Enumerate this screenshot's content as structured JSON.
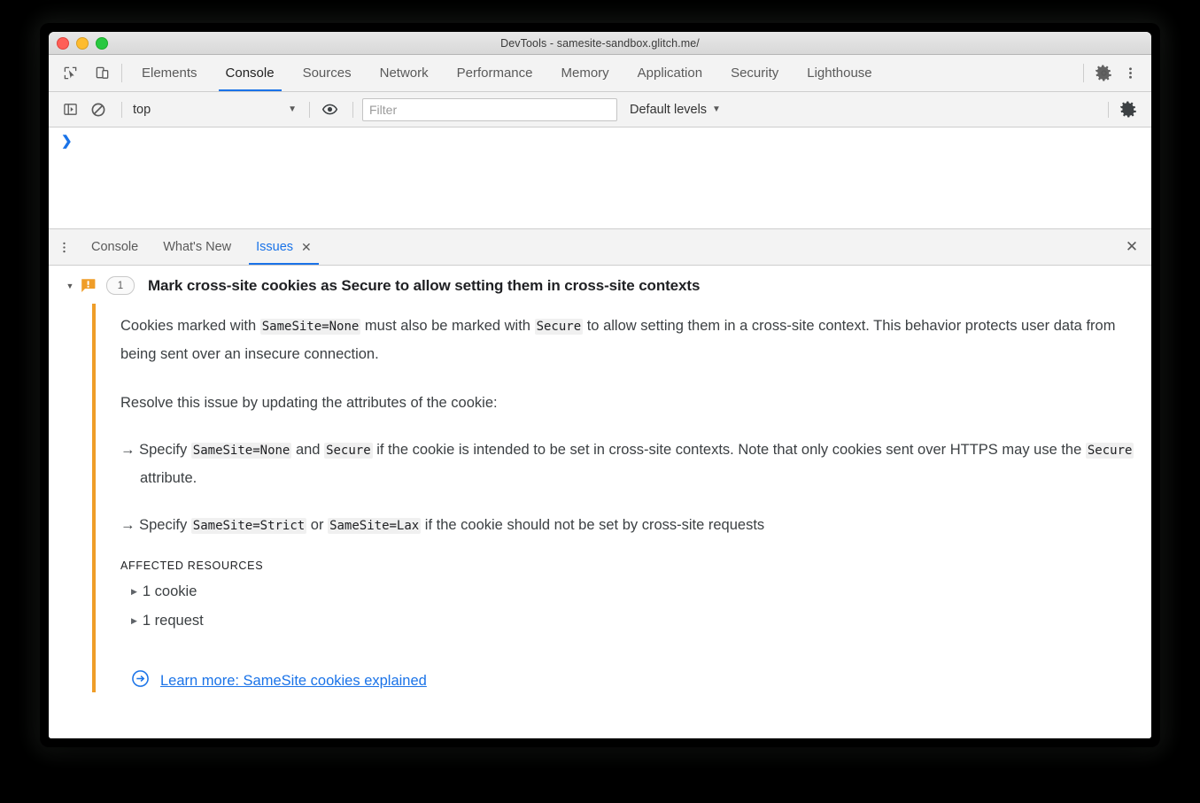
{
  "window": {
    "title": "DevTools - samesite-sandbox.glitch.me/",
    "traffic_lights": [
      "close",
      "minimize",
      "zoom"
    ]
  },
  "main_toolbar": {
    "inspect_icon": "inspect-element-icon",
    "device_icon": "device-toolbar-icon",
    "tabs": [
      {
        "label": "Elements",
        "active": false
      },
      {
        "label": "Console",
        "active": true
      },
      {
        "label": "Sources",
        "active": false
      },
      {
        "label": "Network",
        "active": false
      },
      {
        "label": "Performance",
        "active": false
      },
      {
        "label": "Memory",
        "active": false
      },
      {
        "label": "Application",
        "active": false
      },
      {
        "label": "Security",
        "active": false
      },
      {
        "label": "Lighthouse",
        "active": false
      }
    ],
    "settings_icon": "gear-icon",
    "more_icon": "kebab-menu-icon"
  },
  "console_toolbar": {
    "sidebar_toggle_icon": "console-sidebar-icon",
    "clear_icon": "clear-console-icon",
    "context": "top",
    "context_caret": "▼",
    "eye_icon": "live-expression-icon",
    "filter": {
      "value": "",
      "placeholder": "Filter"
    },
    "levels": "Default levels",
    "levels_caret": "▼",
    "settings_icon": "gear-icon"
  },
  "console_output": {
    "prompt": "❯"
  },
  "drawer": {
    "menu_icon": "kebab-menu-icon",
    "tabs": [
      {
        "label": "Console",
        "active": false,
        "closeable": false
      },
      {
        "label": "What's New",
        "active": false,
        "closeable": false
      },
      {
        "label": "Issues",
        "active": true,
        "closeable": true,
        "close_glyph": "✕"
      }
    ],
    "close_glyph": "✕"
  },
  "issue": {
    "twisty": "▼",
    "severity_icon": "warning-icon",
    "severity_color": "#ef9d28",
    "count": "1",
    "title": "Mark cross-site cookies as Secure to allow setting them in cross-site contexts",
    "paragraph_1": {
      "segments": [
        {
          "t": "Cookies marked with ",
          "code": false
        },
        {
          "t": "SameSite=None",
          "code": true
        },
        {
          "t": " must also be marked with ",
          "code": false
        },
        {
          "t": "Secure",
          "code": true
        },
        {
          "t": " to allow setting them in a cross-site context. This behavior protects user data from being sent over an insecure connection.",
          "code": false
        }
      ]
    },
    "paragraph_2": "Resolve this issue by updating the attributes of the cookie:",
    "bullets": [
      {
        "arrow": "→",
        "segments": [
          {
            "t": " Specify ",
            "code": false
          },
          {
            "t": "SameSite=None",
            "code": true
          },
          {
            "t": " and ",
            "code": false
          },
          {
            "t": "Secure",
            "code": true
          },
          {
            "t": " if the cookie is intended to be set in cross-site contexts. Note that only cookies sent over HTTPS may use the ",
            "code": false
          },
          {
            "t": "Secure",
            "code": true
          },
          {
            "t": " attribute.",
            "code": false
          }
        ]
      },
      {
        "arrow": "→",
        "segments": [
          {
            "t": " Specify ",
            "code": false
          },
          {
            "t": "SameSite=Strict",
            "code": true
          },
          {
            "t": " or ",
            "code": false
          },
          {
            "t": "SameSite=Lax",
            "code": true
          },
          {
            "t": " if the cookie should not be set by cross-site requests",
            "code": false
          }
        ]
      }
    ],
    "affected_resources_label": "AFFECTED RESOURCES",
    "resources": [
      {
        "twisty": "▶",
        "label": "1 cookie"
      },
      {
        "twisty": "▶",
        "label": "1 request"
      }
    ],
    "learn_more": {
      "icon": "arrow-circle-right-icon",
      "label": "Learn more: SameSite cookies explained",
      "color": "#1a73e8"
    }
  }
}
